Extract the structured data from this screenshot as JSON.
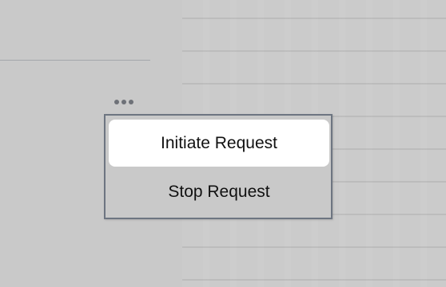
{
  "menu": {
    "items": [
      {
        "label": "Initiate Request",
        "highlighted": true
      },
      {
        "label": "Stop Request",
        "highlighted": false
      }
    ]
  },
  "colors": {
    "panel_left": "#c9c9c9",
    "panel_right": "#cbcbcb",
    "menu_border": "#6d7581",
    "menu_highlight": "#ffffff",
    "dots": "#6e7178"
  },
  "icons": {
    "more": "more-horizontal-icon"
  }
}
